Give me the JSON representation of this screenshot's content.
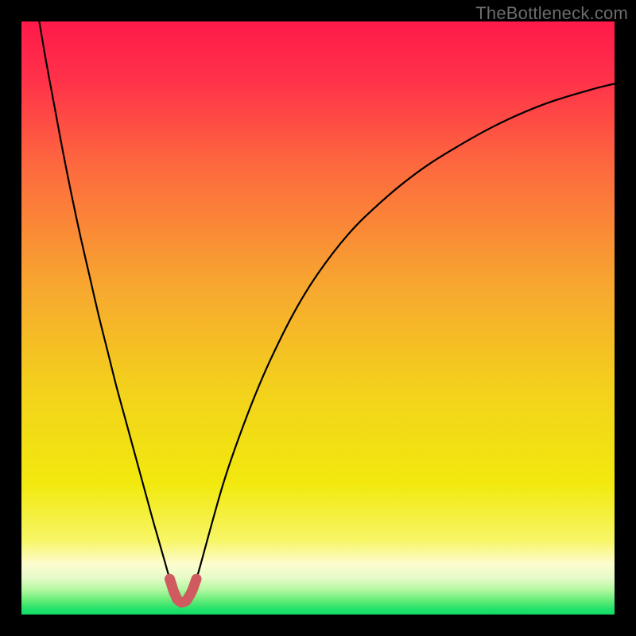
{
  "watermark": "TheBottleneck.com",
  "colors": {
    "bg_black": "#000000",
    "curve_stroke": "#000000",
    "marker_stroke": "#cf5b60",
    "gradient_stops": [
      {
        "offset": 0.0,
        "color": "#ff1a4b"
      },
      {
        "offset": 0.1,
        "color": "#ff3249"
      },
      {
        "offset": 0.25,
        "color": "#fd6b3e"
      },
      {
        "offset": 0.45,
        "color": "#f7a82f"
      },
      {
        "offset": 0.62,
        "color": "#f3d11c"
      },
      {
        "offset": 0.78,
        "color": "#f2e90e"
      },
      {
        "offset": 0.875,
        "color": "#f7f666"
      },
      {
        "offset": 0.915,
        "color": "#fdfccf"
      },
      {
        "offset": 0.938,
        "color": "#e6fbc8"
      },
      {
        "offset": 0.958,
        "color": "#b3f8a1"
      },
      {
        "offset": 0.975,
        "color": "#6aed79"
      },
      {
        "offset": 0.992,
        "color": "#1ee169"
      },
      {
        "offset": 1.0,
        "color": "#14db66"
      }
    ]
  },
  "chart_data": {
    "type": "line",
    "title": "",
    "xlabel": "",
    "ylabel": "",
    "xlim": [
      0,
      100
    ],
    "ylim": [
      0,
      100
    ],
    "series": [
      {
        "name": "bottleneck-curve",
        "x": [
          3.0,
          4.2,
          5.6,
          7.0,
          8.5,
          10.0,
          11.5,
          13.0,
          14.5,
          16.0,
          17.5,
          19.0,
          20.5,
          22.0,
          23.0,
          24.0,
          25.0,
          25.7,
          26.3,
          27.0,
          27.8,
          28.7,
          29.5,
          30.5,
          32.0,
          34.0,
          36.0,
          39.0,
          42.0,
          46.0,
          50.0,
          55.0,
          60.0,
          66.0,
          72.0,
          80.0,
          88.0,
          96.0,
          100.0
        ],
        "y": [
          100.0,
          93.0,
          85.5,
          78.0,
          70.5,
          63.5,
          57.0,
          50.5,
          44.5,
          38.5,
          33.0,
          27.5,
          22.0,
          16.5,
          13.0,
          9.5,
          6.0,
          3.8,
          2.5,
          2.0,
          2.3,
          3.8,
          6.0,
          9.5,
          15.0,
          22.0,
          28.0,
          36.0,
          43.0,
          51.0,
          57.5,
          64.0,
          69.0,
          74.0,
          78.0,
          82.5,
          86.0,
          88.5,
          89.5
        ]
      }
    ],
    "marker_segment": {
      "x_range": [
        25.0,
        29.5
      ],
      "note": "red rounded segment near curve minimum"
    }
  }
}
